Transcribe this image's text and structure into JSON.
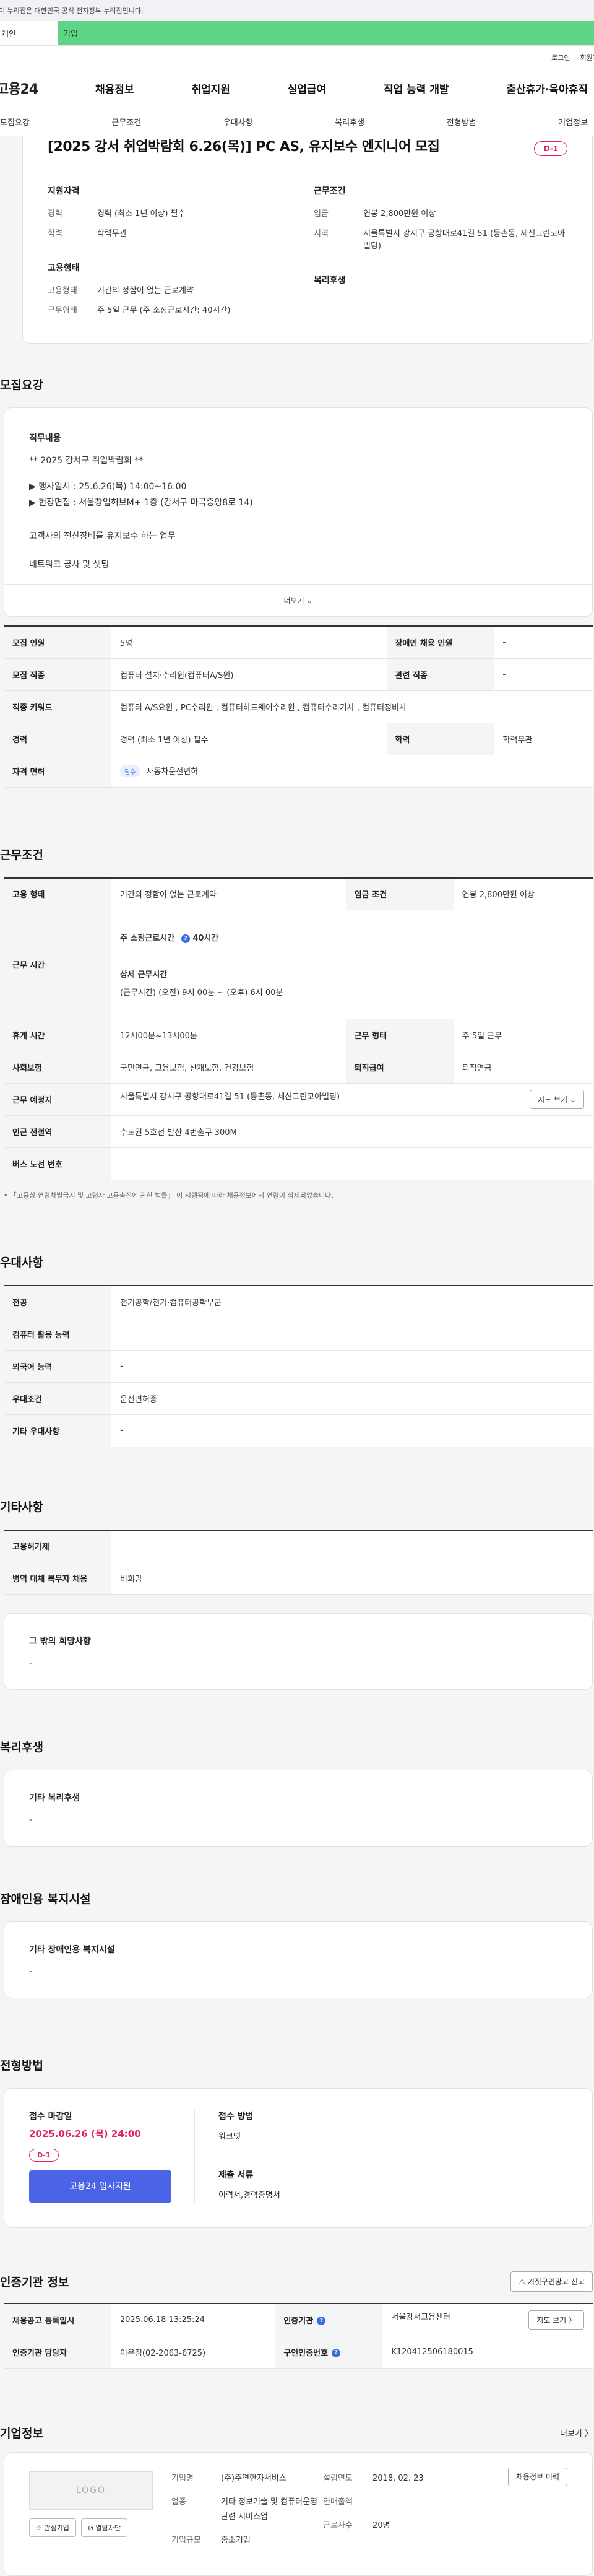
{
  "gov_banner": "이 누리집은 대한민국 공식 전자정부 누리집입니다.",
  "type_tabs": {
    "personal": "개인",
    "company": "기업"
  },
  "util": {
    "login": "로그인",
    "signup": "회원가입"
  },
  "logo": "고용24",
  "gnb": [
    "채용정보",
    "취업지원",
    "실업급여",
    "직업 능력 개발",
    "출산휴가·육아휴직"
  ],
  "anchor_tabs": [
    "모집요강",
    "근무조건",
    "우대사항",
    "복리후생",
    "전형방법",
    "기업정보"
  ],
  "hero": {
    "title": "[2025 강서 취업박람회 6.26(목)] PC AS, 유지보수 엔지니어 모집",
    "dday": "D-1",
    "qual_title": "지원자격",
    "qual": [
      {
        "k": "경력",
        "v": "경력 (최소 1년 이상) 필수"
      },
      {
        "k": "학력",
        "v": "학력무관"
      }
    ],
    "cond_title": "근무조건",
    "cond": [
      {
        "k": "임금",
        "v": "연봉 2,800만원 이상"
      },
      {
        "k": "지역",
        "v": "서울특별시 강서구 공항대로41길 51 (등촌동, 세신그린코아빌딩)"
      }
    ],
    "emp_title": "고용형태",
    "emp": [
      {
        "k": "고용형태",
        "v": "기간의 정함이 없는 근로계약"
      },
      {
        "k": "근무형태",
        "v": "주 5일 근무 (주 소정근로시간: 40시간)"
      }
    ],
    "welfare_title": "복리후생"
  },
  "recruit": {
    "title": "모집요강",
    "duty_title": "직무내용",
    "lines": [
      "** 2025 강서구 취업박람회 **",
      "",
      "▶ 행사일시 : 25.6.26(목) 14:00~16:00",
      "▶ 현장면접 : 서울창업허브M+ 1층 (강서구 마곡중앙8로 14)",
      "",
      "고객사의 전산장비를 유지보수 하는 업무",
      "",
      "네트워크 공사 및 셋팅"
    ],
    "more": "더보기 ⌄",
    "rows": [
      [
        {
          "th": "모집 인원"
        },
        {
          "td": "5명"
        },
        {
          "th": "장애인 채용 인원"
        },
        {
          "td": "-"
        }
      ],
      [
        {
          "th": "모집 직종"
        },
        {
          "td": "컴퓨터 설치·수리원(컴퓨터A/S원)"
        },
        {
          "th": "관련 직종"
        },
        {
          "td": "-"
        }
      ]
    ],
    "keyword_th": "직종 키워드",
    "keyword_td": "컴퓨터 A/S요원 , PC수리원 , 컴퓨터하드웨어수리원 , 컴퓨터수리기사 , 컴퓨터정비사",
    "career_th": "경력",
    "career_td": "경력 (최소 1년 이상) 필수",
    "edu_th": "학력",
    "edu_td": "학력무관",
    "license_th": "자격 면허",
    "license_badge": "필수",
    "license_td": "자동차운전면허"
  },
  "work": {
    "title": "근무조건",
    "emp_th": "고용 형태",
    "emp_td": "기간의 정함이 없는 근로계약",
    "wage_th": "임금 조건",
    "wage_td": "연봉 2,800만원 이상",
    "hours_th": "근무 시간",
    "hours_main": "주 소정근로시간 ",
    "hours_main_val": "40시간",
    "hours_detail_title": "상세 근무시간",
    "hours_detail": "(근무시간) (오전) 9시 00분 ~ (오후) 6시 00분",
    "break_th": "휴게 시간",
    "break_td": "12시00분~13시00분",
    "form_th": "근무 형태",
    "form_td": "주 5일 근무",
    "ins_th": "사회보험",
    "ins_td": "국민연금, 고용보험, 산재보험, 건강보험",
    "sev_th": "퇴직급여",
    "sev_td": "퇴직연금",
    "place_th": "근무 예정지",
    "place_td": "서울특별시 강서구 공항대로41길 51 (등촌동, 세신그린코아빌딩)",
    "map_btn": "지도 보기 ⌄",
    "station_th": "인근 전철역",
    "station_td": "수도권 5호선 발산 4번출구 300M",
    "bus_th": "버스 노선 번호",
    "bus_td": "-",
    "note": "「고용상 연령차별금지 및 고령자 고용촉진에 관한 법률」 이 시행됨에 따라 채용정보에서 연령이 삭제되었습니다."
  },
  "pref": {
    "title": "우대사항",
    "rows": [
      {
        "th": "전공",
        "td": "전기공학/전기·컴퓨터공학부군"
      },
      {
        "th": "컴퓨터 활용 능력",
        "td": "-"
      },
      {
        "th": "외국어 능력",
        "td": "-"
      },
      {
        "th": "우대조건",
        "td": "운전면허증"
      },
      {
        "th": "기타 우대사항",
        "td": "-"
      }
    ]
  },
  "etc": {
    "title": "기타사항",
    "rows": [
      {
        "th": "고용허가제",
        "td": "-"
      },
      {
        "th": "병역 대체 복무자 채용",
        "td": "비희망"
      }
    ],
    "hope_title": "그 밖의 희망사항",
    "hope_val": "-"
  },
  "welfare": {
    "title": "복리후생",
    "sub": "기타 복리후생",
    "val": "-"
  },
  "disabled": {
    "title": "장애인용 복지시설",
    "sub": "기타 장애인용 복지시설",
    "val": "-"
  },
  "process": {
    "title": "전형방법",
    "deadline_title": "접수 마감일",
    "deadline": "2025.06.26 (목) 24:00",
    "dday": "D-1",
    "apply_btn": "고용24 입사지원",
    "method_title": "접수 방법",
    "method": "워크넷",
    "docs_title": "제출 서류",
    "docs": "이력서,경력증명서"
  },
  "cert": {
    "title": "인증기관 정보",
    "report_btn": "⚠ 거짓구인광고 신고",
    "reg_th": "채용공고 등록일시",
    "reg_td": "2025.06.18 13:25:24",
    "org_th": "인증기관",
    "org_td": "서울강서고용센터",
    "map_btn": "지도 보기 〉",
    "mgr_th": "인증기관 담당자",
    "mgr_td": "이은정(02-2063-6725)",
    "no_th": "구인인증번호",
    "no_td": "K120412506180015"
  },
  "company": {
    "title": "기업정보",
    "more": "더보기 〉",
    "logo": "LOGO",
    "fav_btn": "☆ 관심기업",
    "block_btn": "⊘ 열람차단",
    "left": [
      {
        "k": "기업명",
        "v": "(주)주연한자서비스"
      },
      {
        "k": "업종",
        "v": "기타 정보기술 및 컴퓨터운영 관련 서비스업"
      },
      {
        "k": "기업규모",
        "v": "중소기업"
      }
    ],
    "right": [
      {
        "k": "설립연도",
        "v": "2018. 02. 23"
      },
      {
        "k": "연매출액",
        "v": "-"
      },
      {
        "k": "근로자수",
        "v": "20명"
      }
    ],
    "history_btn": "채용정보 이력"
  }
}
